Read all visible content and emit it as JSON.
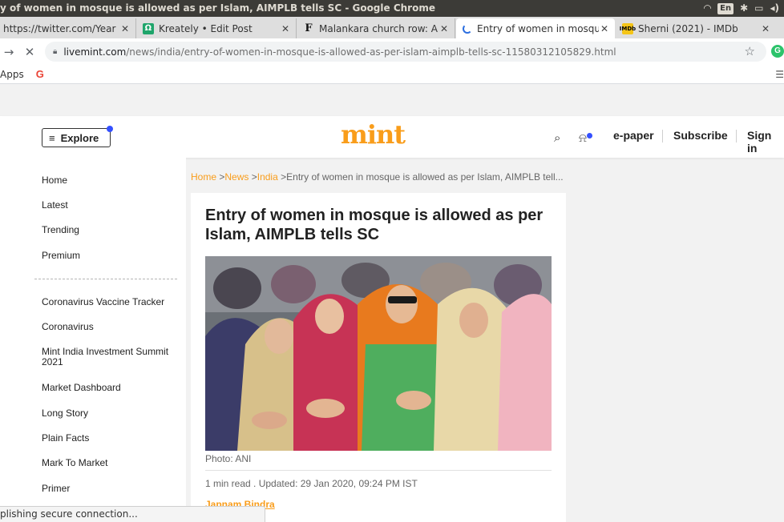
{
  "window": {
    "title": "y of women in mosque is allowed as per Islam, AIMPLB tells SC - Google Chrome",
    "lang_indicator": "En"
  },
  "tabs": [
    {
      "title": "https://twitter.com/Year",
      "favicon": "none"
    },
    {
      "title": "Kreately • Edit Post",
      "favicon": "kreately-icon"
    },
    {
      "title": "Malankara church row: A",
      "favicon": "forbes-icon"
    },
    {
      "title": "Entry of women in mosqu",
      "favicon": "loading-spinner-icon",
      "active": true
    },
    {
      "title": "Sherni (2021) - IMDb",
      "favicon": "imdb-icon"
    }
  ],
  "address_bar": {
    "host": "livemint.com",
    "path": "/news/india/entry-of-women-in-mosque-is-allowed-as-per-islam-aimplb-tells-sc-11580312105829.html"
  },
  "bookmarks": {
    "apps_label": "Apps",
    "google_label": "G"
  },
  "header": {
    "explore_label": "Explore",
    "logo": "mint",
    "epaper_label": "e-paper",
    "subscribe_label": "Subscribe",
    "signin_label": "Sign in"
  },
  "sidebar": {
    "primary": [
      "Home",
      "Latest",
      "Trending",
      "Premium"
    ],
    "secondary": [
      "Coronavirus Vaccine Tracker",
      "Coronavirus",
      "Mint India Investment Summit 2021",
      "Market Dashboard",
      "Long Story",
      "Plain Facts",
      "Mark To Market",
      "Primer"
    ]
  },
  "breadcrumb": {
    "home": "Home",
    "news": "News",
    "india": "India",
    "current": "Entry of women in mosque is allowed as per Islam, AIMPLB tell..."
  },
  "article": {
    "headline": "Entry of women in mosque is allowed as per Islam, AIMPLB tells SC",
    "photo_caption": "Photo: ANI",
    "meta": "1 min read . Updated: 29 Jan 2020, 09:24 PM IST",
    "author": "Japnam Bindra"
  },
  "status": {
    "text": "plishing secure connection..."
  },
  "colors": {
    "brand": "#f99d1b",
    "accent_dot": "#3450ff"
  }
}
